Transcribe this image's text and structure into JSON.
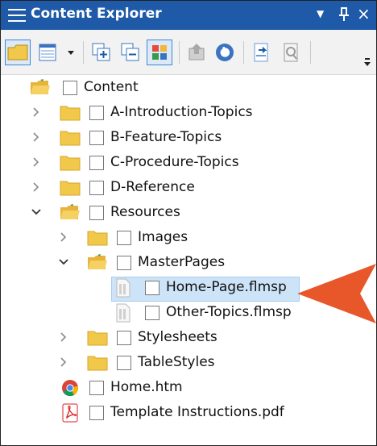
{
  "panel": {
    "title": "Content Explorer",
    "controls": {
      "dropdown_glyph": "▼",
      "pin_glyph": "ᛘ",
      "close_glyph": "×"
    }
  },
  "toolbar": {
    "buttons": [
      "folder-tree-view-icon",
      "list-view-icon",
      "view-dropdown-icon",
      "expand-all-icon",
      "collapse-all-icon",
      "color-tiles-icon",
      "import-icon",
      "refresh-icon",
      "open-file-icon",
      "properties-icon",
      "overflow-icon"
    ]
  },
  "tree": {
    "items": [
      {
        "label": "Content"
      },
      {
        "label": "A-Introduction-Topics"
      },
      {
        "label": "B-Feature-Topics"
      },
      {
        "label": "C-Procedure-Topics"
      },
      {
        "label": "D-Reference"
      },
      {
        "label": "Resources"
      },
      {
        "label": "Images"
      },
      {
        "label": "MasterPages"
      },
      {
        "label": "Home-Page.flmsp"
      },
      {
        "label": "Other-Topics.flmsp"
      },
      {
        "label": "Stylesheets"
      },
      {
        "label": "TableStyles"
      },
      {
        "label": "Home.htm"
      },
      {
        "label": "Template Instructions.pdf"
      }
    ]
  },
  "colors": {
    "title_bar": "#1e5aa8",
    "selection": "#cce3f8",
    "folder": "#f2c84b",
    "callout_arrow": "#e8572a"
  }
}
